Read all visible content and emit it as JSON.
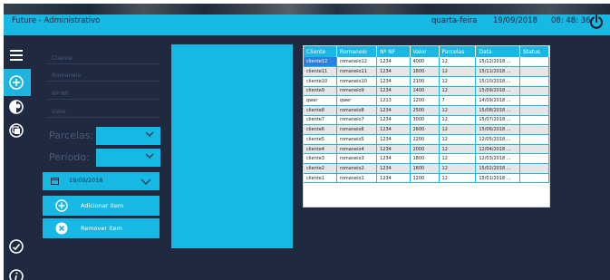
{
  "header": {
    "title": "Future - Administrativo",
    "weekday": "quarta-feira",
    "date": "19/09/2018",
    "time": "08: 48: 36"
  },
  "sidebar": {
    "items": [
      {
        "name": "menu",
        "icon": "hamburger-icon"
      },
      {
        "name": "add",
        "icon": "plus-circle-icon",
        "selected": true
      },
      {
        "name": "toggle",
        "icon": "half-circle-icon"
      },
      {
        "name": "stack",
        "icon": "stack-icon"
      },
      {
        "name": "check",
        "icon": "check-circle-icon"
      },
      {
        "name": "info",
        "icon": "info-icon"
      }
    ]
  },
  "form": {
    "cliente_placeholder": "Cliente",
    "romaneio_placeholder": "Romaneio",
    "nf_placeholder": "Nº NF",
    "valor_placeholder": "Valor",
    "parcelas_label": "Parcelas:",
    "periodo_label": "Período:",
    "date_value": "19/09/2018",
    "add_label": "Adicionar item",
    "remove_label": "Remover item"
  },
  "table": {
    "headers": [
      "Cliente",
      "Romaneio",
      "Nº NF",
      "Valor",
      "Parcelas",
      "Data",
      "Status"
    ],
    "rows": [
      [
        "cliente12",
        "romaneio12",
        "1234",
        "4000",
        "12",
        "15/12/2018 ...",
        ""
      ],
      [
        "cliente11",
        "romaneio11",
        "1234",
        "1600",
        "12",
        "15/11/2018 ...",
        ""
      ],
      [
        "cliente10",
        "romaneio10",
        "1234",
        "2100",
        "12",
        "15/10/2018 ...",
        ""
      ],
      [
        "cliente9",
        "romaneio9",
        "1234",
        "1400",
        "12",
        "15/09/2018 ...",
        ""
      ],
      [
        "qwer",
        "qwer",
        "1213",
        "1200",
        "7",
        "14/09/2018 ...",
        ""
      ],
      [
        "cliente8",
        "romaneio8",
        "1234",
        "2500",
        "12",
        "15/08/2018 ...",
        ""
      ],
      [
        "cliente7",
        "romaneio7",
        "1234",
        "3000",
        "12",
        "15/07/2018 ...",
        ""
      ],
      [
        "cliente6",
        "romaneio6",
        "1234",
        "2600",
        "12",
        "15/06/2018 ...",
        ""
      ],
      [
        "cliente5",
        "romaneio5",
        "1234",
        "2200",
        "12",
        "12/05/2018 ...",
        ""
      ],
      [
        "cliente4",
        "romaneio4",
        "1234",
        "2000",
        "12",
        "12/04/2018 ...",
        ""
      ],
      [
        "cliente3",
        "romaneio3",
        "1234",
        "1800",
        "12",
        "12/03/2018 ...",
        ""
      ],
      [
        "cliente2",
        "romaneio2",
        "1234",
        "1600",
        "12",
        "15/02/2018 ...",
        ""
      ],
      [
        "cliente1",
        "romaneio1",
        "1234",
        "1200",
        "12",
        "15/01/2018 ...",
        ""
      ]
    ]
  },
  "colors": {
    "accent": "#17b8e3",
    "background": "#1f2940",
    "selection": "#2f7fe0"
  }
}
